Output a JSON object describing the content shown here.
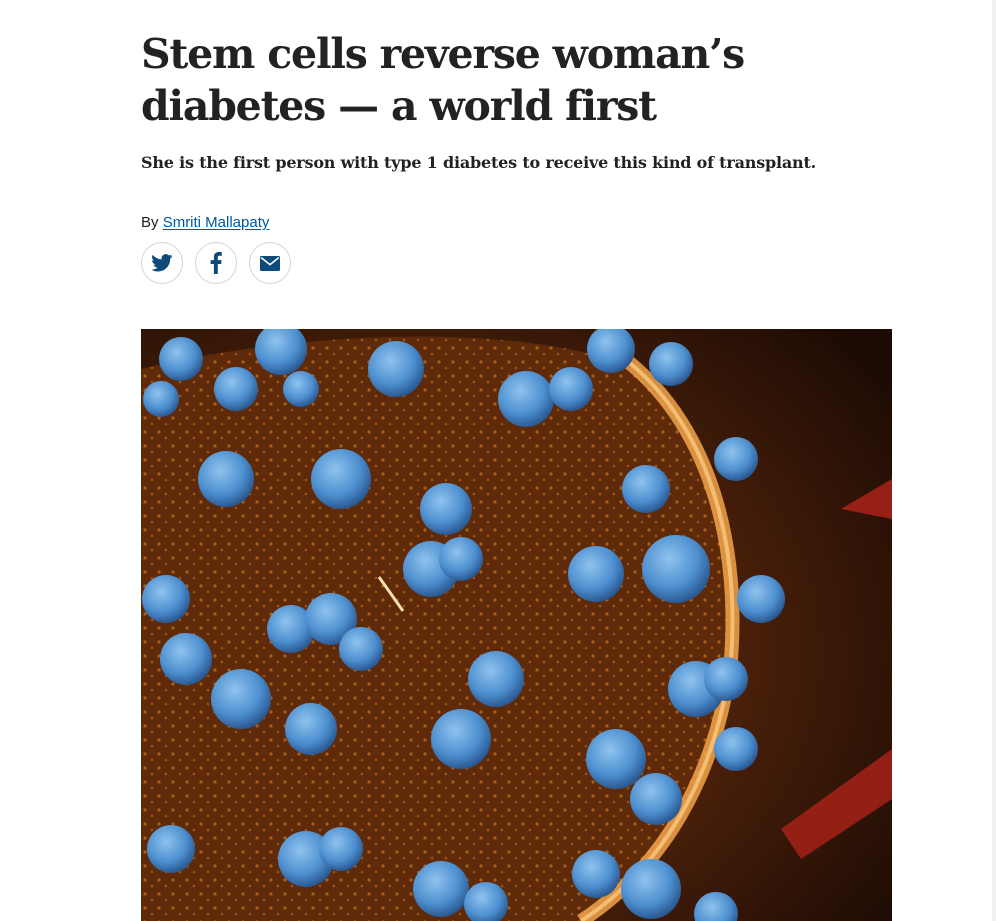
{
  "article": {
    "headline": "Stem cells reverse woman’s diabetes — a world first",
    "standfirst": "She is the first person with type 1 diabetes to receive this kind of transplant.",
    "byline_prefix": "By",
    "author": "Smriti Mallapaty"
  },
  "share": [
    {
      "network": "twitter",
      "icon": "twitter-icon"
    },
    {
      "network": "facebook",
      "icon": "facebook-icon"
    },
    {
      "network": "email",
      "icon": "email-icon"
    }
  ],
  "hero_image": {
    "subject": "false-colour micrograph of cells",
    "colors": {
      "background": "#2a1204",
      "orange": "#e07a18",
      "blue": "#4d8fcf",
      "red": "#b4231a"
    }
  },
  "theme": {
    "link_color": "#01579b",
    "text_color": "#222222",
    "icon_color": "#0c4a7a"
  }
}
